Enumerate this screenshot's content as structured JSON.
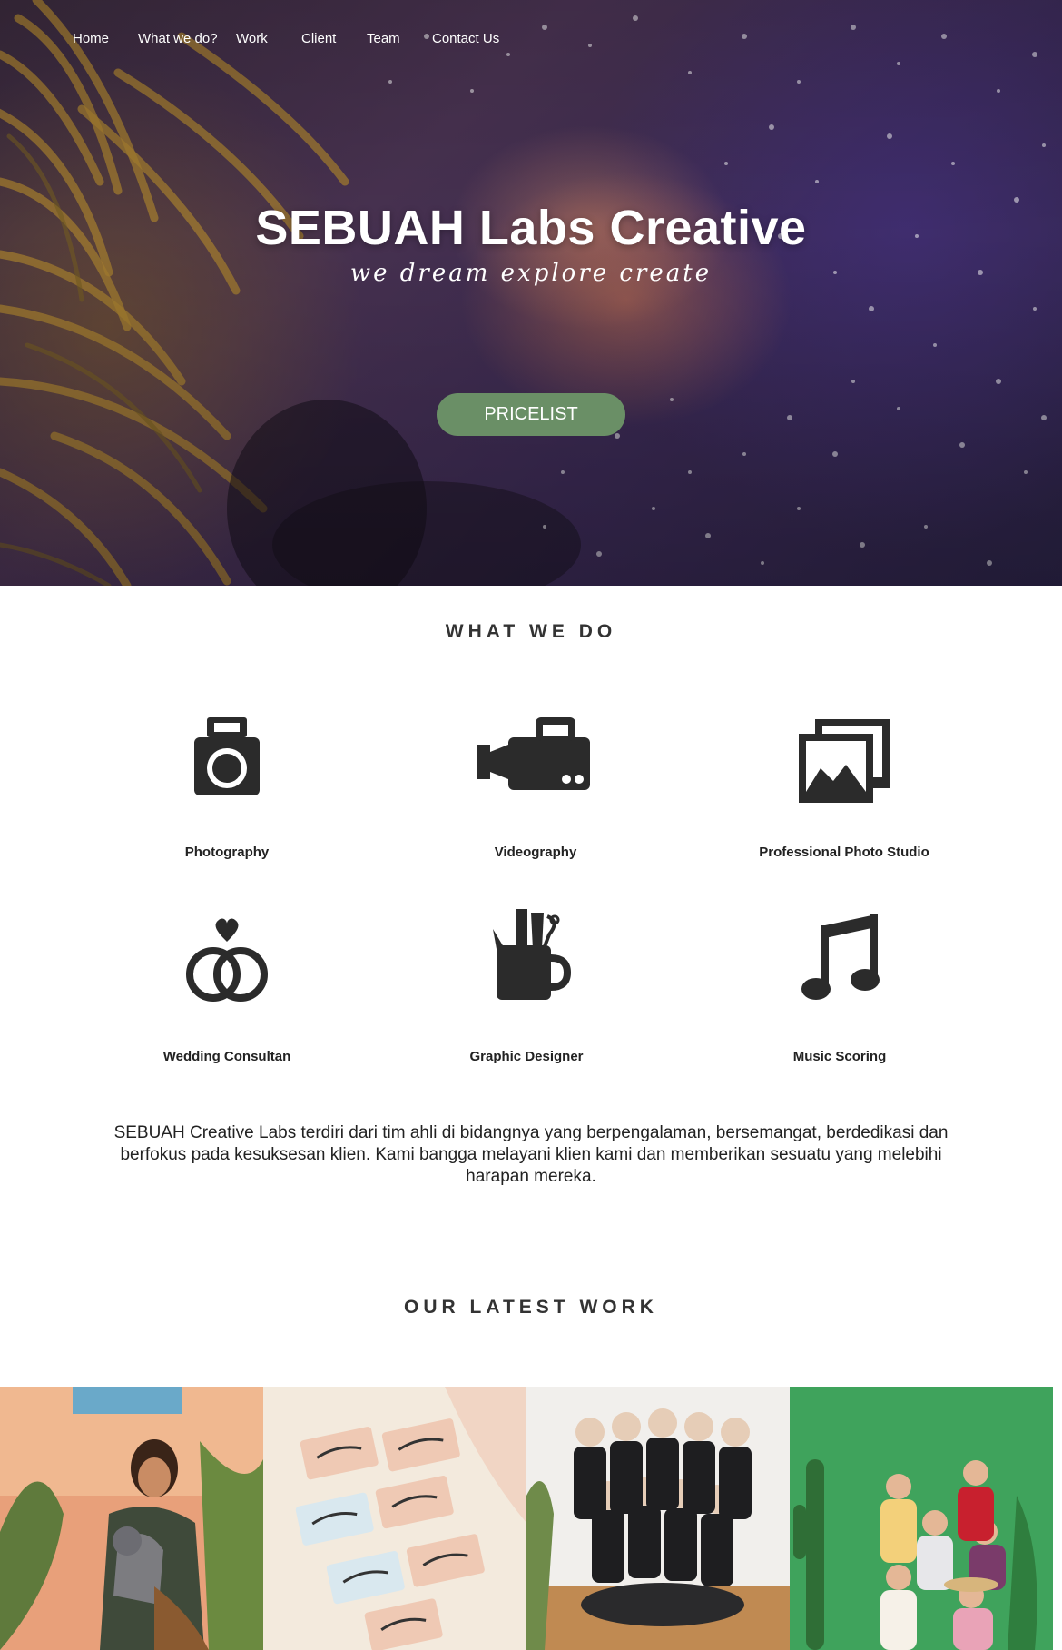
{
  "nav": {
    "items": [
      {
        "label": "Home"
      },
      {
        "label": "What we do?"
      },
      {
        "label": "Work"
      },
      {
        "label": "Client"
      },
      {
        "label": "Team"
      },
      {
        "label": "Contact Us"
      }
    ]
  },
  "hero": {
    "title": "SEBUAH Labs Creative",
    "tagline": "we dream explore create",
    "button_label": "PRICELIST",
    "button_color": "#6a8f66"
  },
  "what_we_do": {
    "heading": "WHAT WE DO",
    "services": [
      {
        "label": "Photography",
        "icon": "camera-icon"
      },
      {
        "label": "Videography",
        "icon": "video-camera-icon"
      },
      {
        "label": "Professional Photo Studio",
        "icon": "photo-gallery-icon"
      },
      {
        "label": "Wedding Consultan",
        "icon": "wedding-rings-icon"
      },
      {
        "label": "Graphic Designer",
        "icon": "design-tools-icon"
      },
      {
        "label": "Music Scoring",
        "icon": "music-note-icon"
      }
    ],
    "description": "SEBUAH Creative Labs terdiri dari tim ahli di bidangnya yang berpengalaman, bersemangat, berdedikasi dan berfokus pada kesuksesan klien. Kami bangga melayani klien kami dan memberikan sesuatu yang melebihi harapan mereka."
  },
  "latest_work": {
    "heading": "OUR LATEST WORK"
  }
}
